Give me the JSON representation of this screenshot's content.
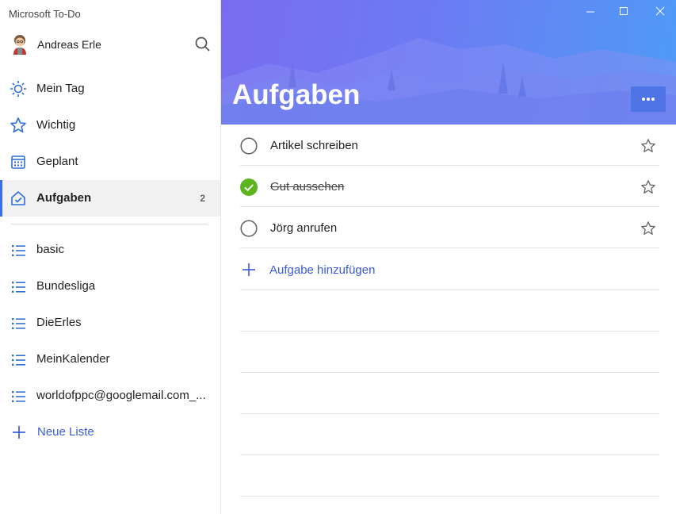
{
  "app": {
    "title": "Microsoft To-Do"
  },
  "user": {
    "name": "Andreas Erle"
  },
  "nav": {
    "items": [
      {
        "label": "Mein Tag",
        "icon": "sun-icon"
      },
      {
        "label": "Wichtig",
        "icon": "star-icon"
      },
      {
        "label": "Geplant",
        "icon": "calendar-icon"
      },
      {
        "label": "Aufgaben",
        "icon": "home-icon",
        "count": "2",
        "active": true
      }
    ]
  },
  "lists": {
    "items": [
      {
        "label": "basic"
      },
      {
        "label": "Bundesliga"
      },
      {
        "label": "DieErles"
      },
      {
        "label": "MeinKalender"
      },
      {
        "label": "worldofppc@googlemail.com_..."
      }
    ],
    "new_list_label": "Neue Liste"
  },
  "main": {
    "title": "Aufgaben",
    "tasks": [
      {
        "title": "Artikel schreiben",
        "completed": false
      },
      {
        "title": "Gut aussehen",
        "completed": true
      },
      {
        "title": "Jörg anrufen",
        "completed": false
      }
    ],
    "add_task_label": "Aufgabe hinzufügen"
  },
  "colors": {
    "accent": "#3b5bdb",
    "complete": "#5cb51f",
    "header_gradient_start": "#7a6cf0",
    "header_gradient_end": "#4f9bf6"
  }
}
